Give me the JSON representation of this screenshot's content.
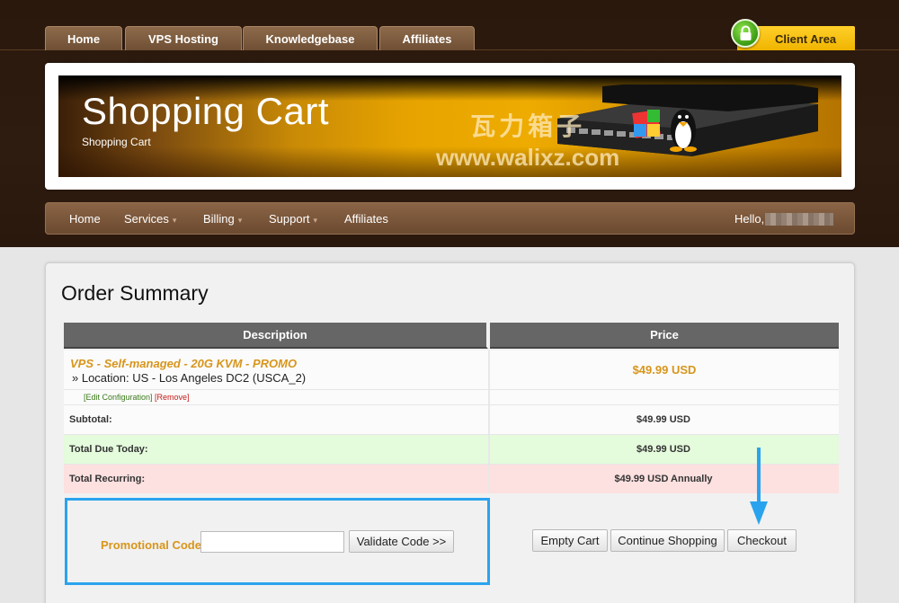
{
  "top_nav": {
    "tabs": [
      "Home",
      "VPS Hosting",
      "Knowledgebase",
      "Affiliates"
    ],
    "client_area": "Client Area"
  },
  "banner": {
    "title": "Shopping Cart",
    "subtitle": "Shopping Cart",
    "watermark_cn": "瓦力箱子",
    "watermark_url": "www.walixz.com"
  },
  "main_nav": {
    "items": [
      "Home",
      "Services",
      "Billing",
      "Support",
      "Affiliates"
    ],
    "dropdown_caret": "▾",
    "hello": "Hello,"
  },
  "order": {
    "title": "Order Summary",
    "columns": [
      "Description",
      "Price"
    ],
    "item": {
      "name": "VPS - Self-managed - 20G KVM - PROMO",
      "location": "» Location: US - Los Angeles DC2 (USCA_2)",
      "price": "$49.99 USD",
      "edit_link": "[Edit Configuration]",
      "remove_link": "[Remove]"
    },
    "subtotal": {
      "label": "Subtotal:",
      "value": "$49.99 USD"
    },
    "total_due": {
      "label": "Total Due Today:",
      "value": "$49.99 USD"
    },
    "total_recurring": {
      "label": "Total Recurring:",
      "value": "$49.99 USD Annually"
    }
  },
  "promo": {
    "label": "Promotional Code",
    "input_value": "",
    "validate_button": "Validate Code >>"
  },
  "actions": {
    "empty_cart": "Empty Cart",
    "continue_shopping": "Continue Shopping",
    "checkout": "Checkout"
  },
  "colors": {
    "accent_orange": "#d8951b",
    "annotation_blue": "#2aa3ee",
    "due_bg": "#e4fbdc",
    "recurring_bg": "#fde0e0"
  }
}
